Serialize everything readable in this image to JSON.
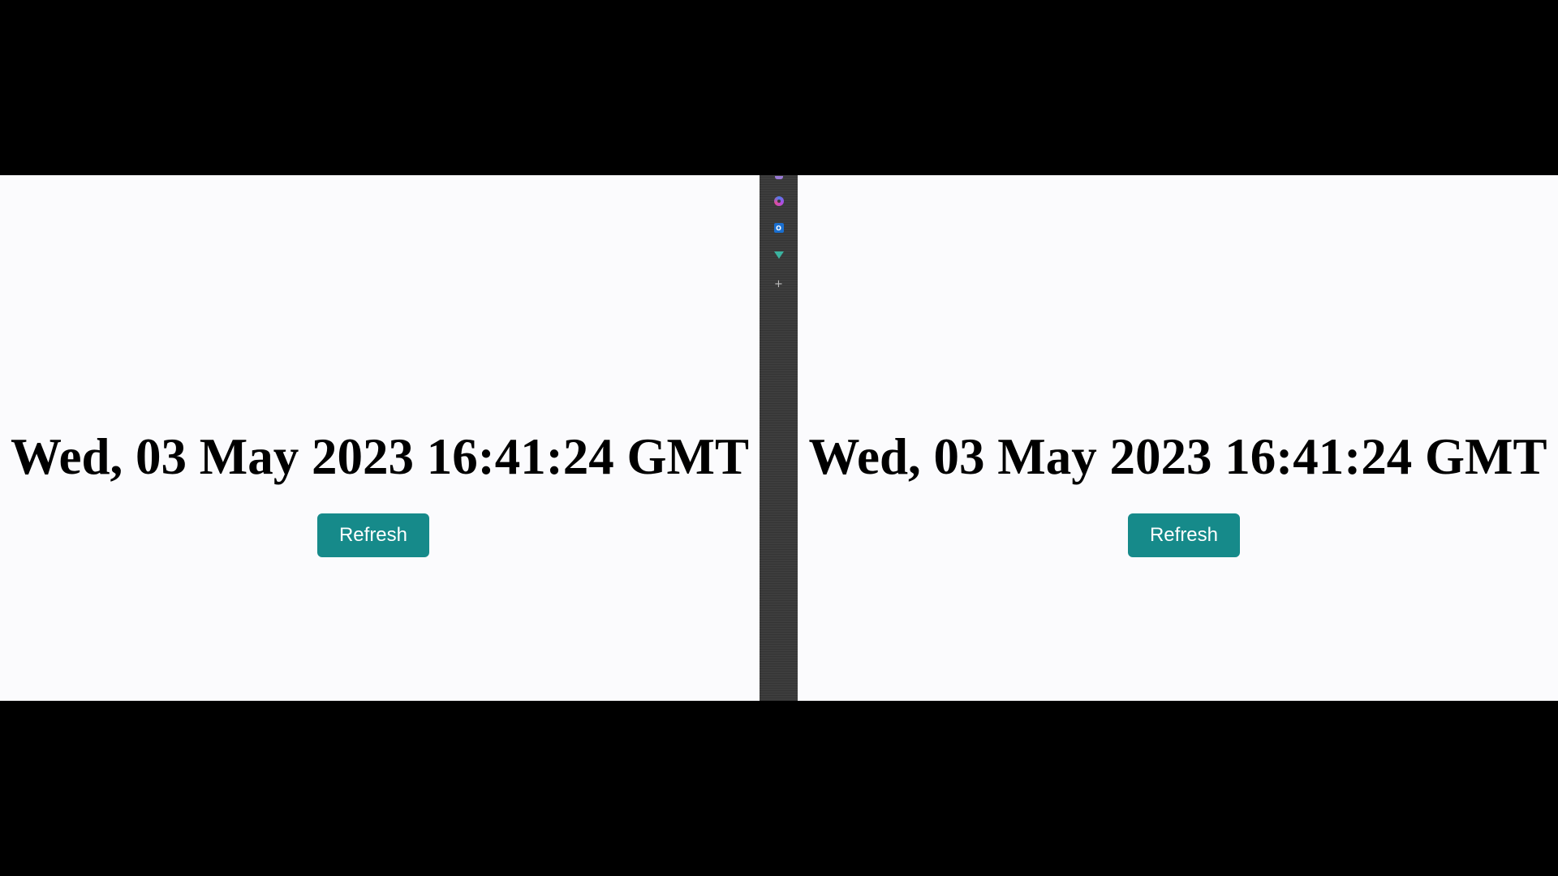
{
  "left_pane": {
    "date_text": "Wed, 03 May 2023 16:41:24 GMT",
    "refresh_label": "Refresh"
  },
  "right_pane": {
    "date_text": "Wed, 03 May 2023 16:41:24 GMT",
    "refresh_label": "Refresh"
  },
  "sidebar": {
    "icons": [
      "profile-icon",
      "copilot-icon",
      "outlook-icon",
      "drop-icon",
      "add-icon"
    ],
    "outlook_letter": "O",
    "add_glyph": "+"
  },
  "colors": {
    "button_bg": "#168a8a",
    "pane_bg": "#fbfbfd",
    "sidebar_bg": "#3a3a3a"
  }
}
